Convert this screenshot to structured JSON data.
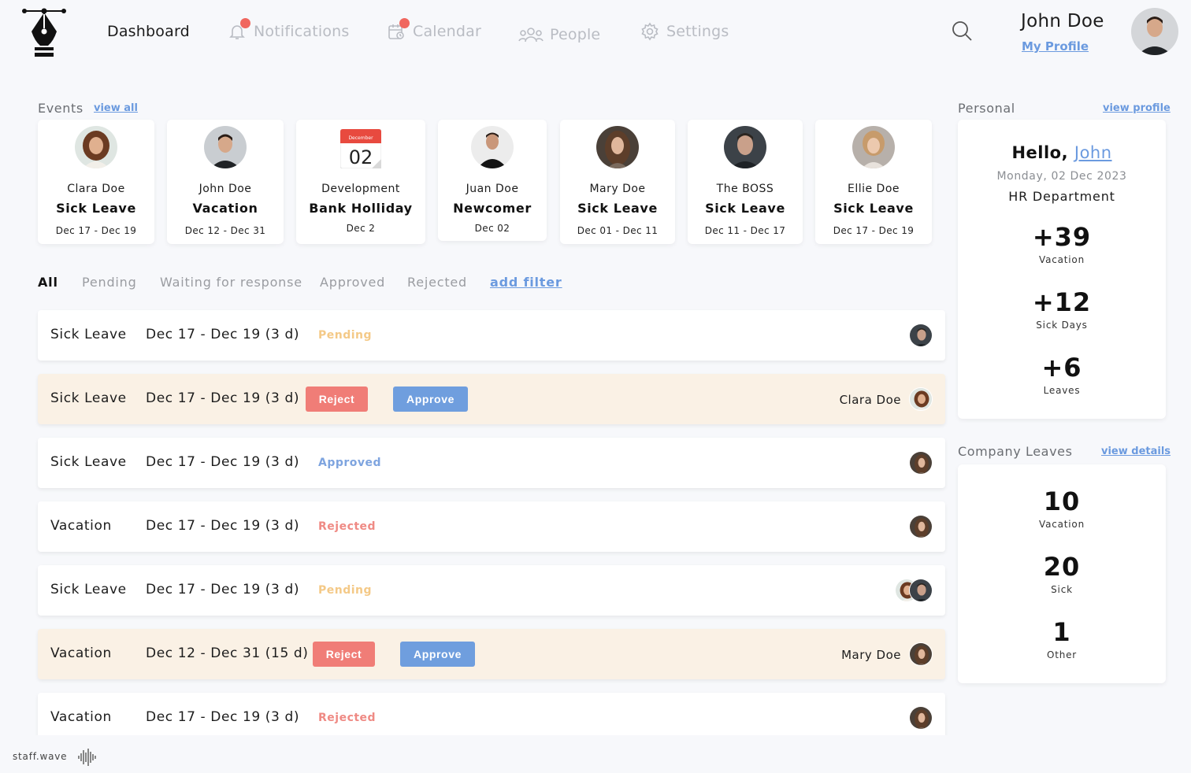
{
  "nav": {
    "dashboard": "Dashboard",
    "notifications": "Notifications",
    "calendar": "Calendar",
    "people": "People",
    "settings": "Settings"
  },
  "user": {
    "name": "John Doe",
    "profile_link": "My Profile"
  },
  "events": {
    "title": "Events",
    "view_all": "view all",
    "items": [
      {
        "name": "Clara Doe",
        "type": "Sick Leave",
        "date": "Dec 17 - Dec 19",
        "avatar": "woman-curly"
      },
      {
        "name": "John Doe",
        "type": "Vacation",
        "date": "Dec 12 - Dec 31",
        "avatar": "man-dark"
      },
      {
        "name": "Development",
        "type": "Bank Holliday",
        "date": "Dec 2",
        "cal_month": "December",
        "cal_day": "02"
      },
      {
        "name": "Juan Doe",
        "type": "Newcomer",
        "date": "Dec 02",
        "avatar": "man-tshirt"
      },
      {
        "name": "Mary Doe",
        "type": "Sick Leave",
        "date": "Dec 01 - Dec 11",
        "avatar": "woman-brown"
      },
      {
        "name": "The BOSS",
        "type": "Sick Leave",
        "date": "Dec 11 - Dec 17",
        "avatar": "man-stubble"
      },
      {
        "name": "Ellie Doe",
        "type": "Sick Leave",
        "date": "Dec 17 - Dec 19",
        "avatar": "woman-blonde"
      }
    ]
  },
  "filters": {
    "all": "All",
    "pending": "Pending",
    "waiting": "Waiting for response",
    "approved": "Approved",
    "rejected": "Rejected",
    "add": "add filter"
  },
  "buttons": {
    "reject": "Reject",
    "approve": "Approve"
  },
  "requests": [
    {
      "type": "Sick Leave",
      "dates": "Dec 17 - Dec 19 (3 d)",
      "status": "Pending",
      "person": ""
    },
    {
      "type": "Sick Leave",
      "dates": "Dec 17 - Dec 19 (3 d)",
      "status": "",
      "person": "Clara Doe"
    },
    {
      "type": "Sick Leave",
      "dates": "Dec 17 - Dec 19 (3 d)",
      "status": "Approved",
      "person": ""
    },
    {
      "type": "Vacation",
      "dates": "Dec 17 - Dec 19 (3 d)",
      "status": "Rejected",
      "person": ""
    },
    {
      "type": "Sick Leave",
      "dates": "Dec 17 - Dec 19 (3 d)",
      "status": "Pending",
      "person": ""
    },
    {
      "type": "Vacation",
      "dates": "Dec 12 - Dec 31 (15 d)",
      "status": "",
      "person": "Mary Doe"
    },
    {
      "type": "Vacation",
      "dates": "Dec 17 - Dec 19 (3 d)",
      "status": "Rejected",
      "person": ""
    }
  ],
  "personal": {
    "title": "Personal",
    "view_profile": "view profile",
    "hello": "Hello,",
    "first_name": "John",
    "date": "Monday, 02 Dec 2023",
    "department": "HR Department",
    "stats": [
      {
        "value": "+39",
        "label": "Vacation"
      },
      {
        "value": "+12",
        "label": "Sick Days"
      },
      {
        "value": "+6",
        "label": "Leaves"
      }
    ]
  },
  "company": {
    "title": "Company Leaves",
    "view_details": "view details",
    "stats": [
      {
        "value": "10",
        "label": "Vacation"
      },
      {
        "value": "20",
        "label": "Sick"
      },
      {
        "value": "1",
        "label": "Other"
      }
    ]
  },
  "footer": {
    "brand": "staff.wave"
  },
  "colors": {
    "accent": "#6b9adf",
    "reject": "#f07d77",
    "approve": "#6f9ede",
    "pending": "#f4c987",
    "approved": "#7ea4df",
    "rejected": "#ef8a84",
    "highlight_row": "#faf1e5",
    "notification_dot": "#f0675f"
  }
}
